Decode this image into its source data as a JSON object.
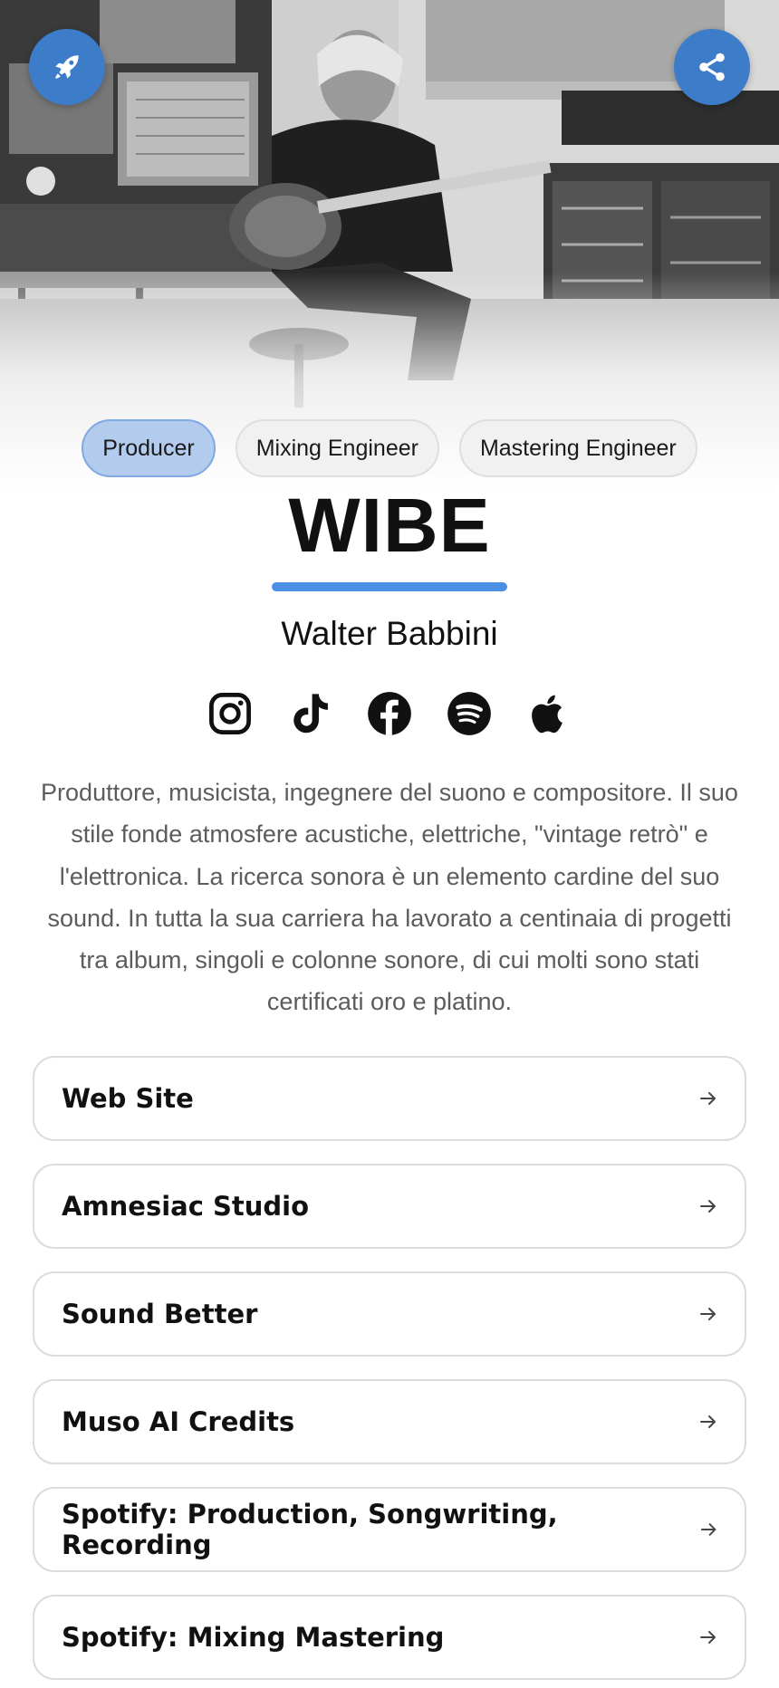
{
  "hero": {
    "launch_button_icon": "rocket-icon",
    "share_button_icon": "share-icon"
  },
  "roles": [
    {
      "label": "Producer",
      "active": true
    },
    {
      "label": "Mixing Engineer",
      "active": false
    },
    {
      "label": "Mastering Engineer",
      "active": false
    }
  ],
  "profile": {
    "title": "WIBE",
    "name": "Walter Babbini",
    "accent_color": "#4a8ee6",
    "button_color": "#3d7cc9"
  },
  "socials": [
    {
      "icon": "instagram-icon"
    },
    {
      "icon": "tiktok-icon"
    },
    {
      "icon": "facebook-icon"
    },
    {
      "icon": "spotify-icon"
    },
    {
      "icon": "apple-icon"
    }
  ],
  "bio": "Produttore, musicista, ingegnere del suono e compositore. Il suo stile fonde atmosfere acustiche, elettriche, \"vintage retrò\" e l'elettronica. La ricerca sonora è un elemento cardine del suo sound. In tutta la sua carriera ha lavorato a centinaia di progetti tra album, singoli e colonne sonore, di cui molti sono stati certificati oro e platino.",
  "links": [
    {
      "label": "Web Site"
    },
    {
      "label": "Amnesiac Studio"
    },
    {
      "label": "Sound Better"
    },
    {
      "label": "Muso AI Credits"
    },
    {
      "label": "Spotify: Production, Songwriting, Recording"
    },
    {
      "label": "Spotify: Mixing Mastering"
    }
  ]
}
